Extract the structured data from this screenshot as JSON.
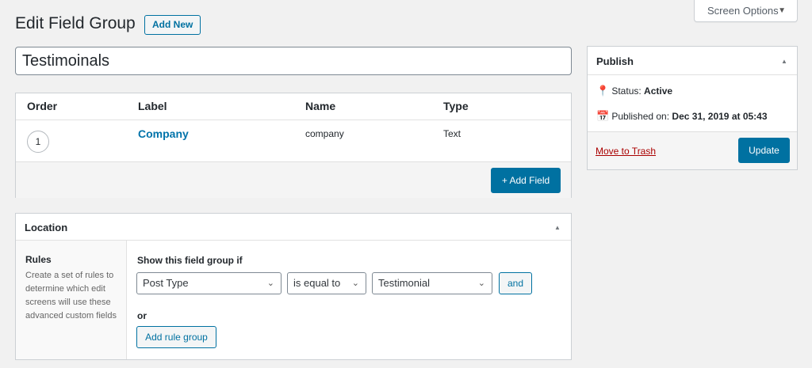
{
  "header": {
    "title": "Edit Field Group",
    "add_new_label": "Add New",
    "screen_options_label": "Screen Options"
  },
  "title_input": {
    "value": "Testimoinals"
  },
  "fields": {
    "columns": {
      "order": "Order",
      "label": "Label",
      "name": "Name",
      "type": "Type"
    },
    "rows": [
      {
        "order": "1",
        "label": "Company",
        "name": "company",
        "type": "Text"
      }
    ],
    "add_field_label": "+ Add Field"
  },
  "location": {
    "title": "Location",
    "rules_label": "Rules",
    "rules_description": "Create a set of rules to determine which edit screens will use these advanced custom fields",
    "show_if_label": "Show this field group if",
    "rule": {
      "param": "Post Type",
      "operator": "is equal to",
      "value": "Testimonial"
    },
    "and_label": "and",
    "or_label": "or",
    "add_rule_group_label": "Add rule group"
  },
  "publish": {
    "title": "Publish",
    "status_label": "Status:",
    "status_value": "Active",
    "published_label": "Published on:",
    "published_value": "Dec 31, 2019 at 05:43",
    "trash_label": "Move to Trash",
    "update_label": "Update"
  },
  "colors": {
    "primary": "#0071a1",
    "link": "#0073aa",
    "danger": "#a00000",
    "background": "#f1f1f1"
  },
  "icons": {
    "screen_options_caret": "caret-down-icon",
    "toggle": "triangle-up-icon",
    "status": "pin-icon",
    "published": "calendar-icon",
    "select": "chevron-down-icon"
  }
}
